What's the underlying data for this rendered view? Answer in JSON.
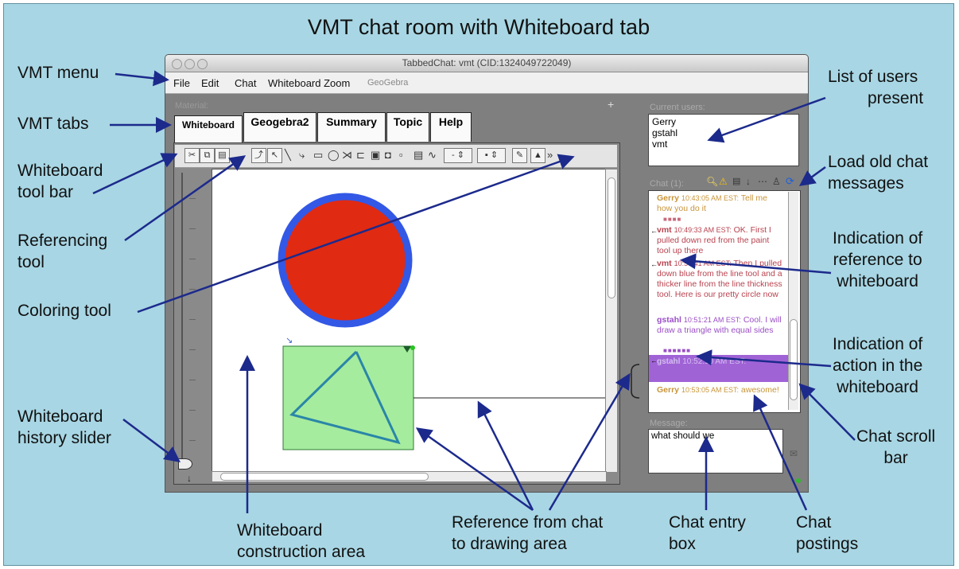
{
  "slide": {
    "title": "VMT chat room with Whiteboard tab"
  },
  "annotations": {
    "vmt_menu": "VMT menu",
    "vmt_tabs": "VMT tabs",
    "toolbar": [
      "Whiteboard",
      "tool bar"
    ],
    "referencing": [
      "Referencing",
      "tool"
    ],
    "coloring": "Coloring tool",
    "history": [
      "Whiteboard",
      "history slider"
    ],
    "construction": [
      "Whiteboard",
      "construction area"
    ],
    "reference_from_chat": [
      "Reference from chat",
      "to drawing area"
    ],
    "chat_entry": [
      "Chat entry",
      "box"
    ],
    "chat_postings": [
      "Chat",
      "postings"
    ],
    "users_present": [
      "List of users",
      "present"
    ],
    "load_old": [
      "Load old chat",
      "messages"
    ],
    "indication_reference": [
      "Indication of",
      "reference to",
      "whiteboard"
    ],
    "indication_action": [
      "Indication of",
      "action in the",
      "whiteboard"
    ],
    "chat_scroll": [
      "Chat scroll",
      "bar"
    ]
  },
  "window": {
    "title": "TabbedChat: vmt (CID:1324049722049)",
    "menu": [
      "File",
      "Edit",
      "Chat",
      "Whiteboard Zoom",
      "GeoGebra"
    ],
    "material_label": "Material:",
    "tabs": [
      "Whiteboard",
      "Geogebra2",
      "Summary",
      "Topic",
      "Help"
    ]
  },
  "users": {
    "label": "Current users:",
    "list": [
      "Gerry",
      "gstahl",
      "vmt"
    ]
  },
  "chat": {
    "label": "Chat (1):",
    "posts": [
      {
        "name": "Gerry",
        "time": "10:43:05 AM EST:",
        "text": "Tell me how you do it",
        "color": "#c8953a"
      },
      {
        "name": "vmt",
        "time": "10:49:33 AM EST:",
        "text": "OK. First I pulled down red from the paint tool up there",
        "color": "#b8434f"
      },
      {
        "name": "vmt",
        "time": "10:50:41 AM EST:",
        "text": "Then I pulled down blue from the line tool and a thicker line from the line thickness tool. Here is our pretty circle now",
        "color": "#b8434f"
      },
      {
        "name": "gstahl",
        "time": "10:51:21 AM EST:",
        "text": "Cool. I will draw a triangle with equal sides",
        "color": "#9a4fc6"
      },
      {
        "name": "gstahl",
        "time": "10:52:10 AM EST:",
        "text": "",
        "color": "#ffffff"
      },
      {
        "name": "Gerry",
        "time": "10:53:05 AM EST:",
        "text": "awesome!",
        "color": "#c8953a"
      }
    ]
  },
  "message": {
    "label": "Message:",
    "value": "what should we"
  },
  "colors": {
    "background": "#a8d6e4",
    "circle_fill": "#e02a12",
    "circle_stroke": "#3358e6",
    "rect_fill": "#a6ec9e",
    "arrow": "#1c2a8c",
    "highlight": "#a063d6"
  }
}
